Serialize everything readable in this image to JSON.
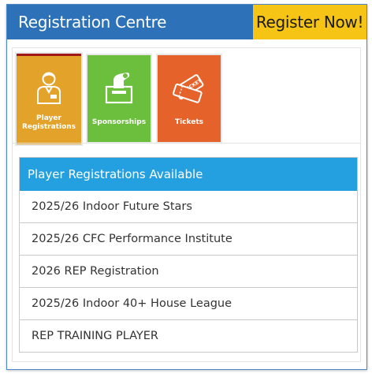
{
  "header": {
    "title": "Registration Centre",
    "register_button": "Register Now!"
  },
  "tiles": [
    {
      "label": "Player Registrations",
      "icon": "player-icon",
      "color": "#e3a22a"
    },
    {
      "label": "Sponsorships",
      "icon": "sponsorship-icon",
      "color": "#6bbf3d"
    },
    {
      "label": "Tickets",
      "icon": "tickets-icon",
      "color": "#e6622b"
    }
  ],
  "tile_player_lines": [
    "Player",
    "Registrations"
  ],
  "panel": {
    "heading": "Player Registrations Available",
    "items": [
      "2025/26 Indoor Future Stars",
      "2025/26 CFC Performance Institute",
      "2026 REP Registration",
      "2025/26 Indoor 40+ House League",
      "REP TRAINING PLAYER"
    ]
  },
  "colors": {
    "header": "#2d72b9",
    "register": "#f6c415",
    "list_header": "#24a0e0",
    "active_tile_border": "#a01818"
  }
}
